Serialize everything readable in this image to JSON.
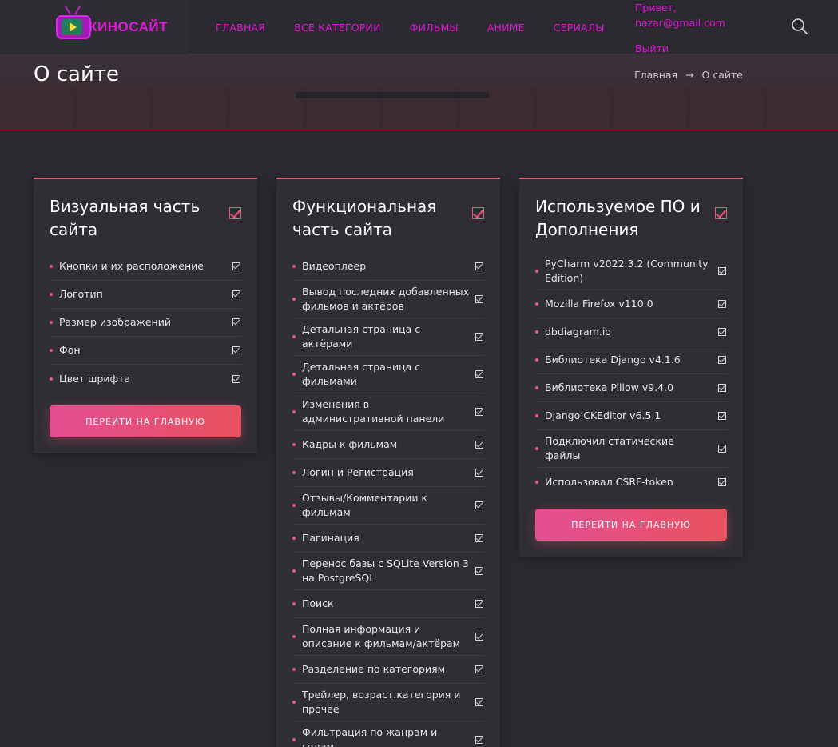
{
  "header": {
    "logo_text": "КИНОСАЙТ",
    "nav": [
      "ГЛАВНАЯ",
      "ВСЕ КАТЕГОРИИ",
      "ФИЛЬМЫ",
      "АНИМЕ",
      "СЕРИАЛЫ"
    ],
    "greeting": "Привет,",
    "email": "nazar@gmail.com",
    "logout": "Выйти",
    "search_icon": "search-icon"
  },
  "hero": {
    "title": "О сайте",
    "breadcrumb_home": "Главная",
    "breadcrumb_sep": "→",
    "breadcrumb_current": "О сайте"
  },
  "cards": [
    {
      "title": "Визуальная часть сайта",
      "items": [
        "Кнопки и их расположение",
        "Логотип",
        "Размер изображений",
        "Фон",
        "Цвет шрифта"
      ],
      "button": "ПЕРЕЙТИ НА ГЛАВНУЮ"
    },
    {
      "title": "Функциональная часть сайта",
      "items": [
        "Видеоплеер",
        "Вывод последних добавленных фильмов и актёров",
        "Детальная страница с актёрами",
        "Детальная страница с фильмами",
        "Изменения в административной панели",
        "Кадры к фильмам",
        "Логин и Регистрация",
        "Отзывы/Комментарии к фильмам",
        "Пагинация",
        "Перенос базы с SQLite Version 3 на PostgreSQL",
        "Поиск",
        "Полная информация и описание к фильмам/актёрам",
        "Разделение по категориям",
        "Трейлер, возраст.категория и прочее",
        "Фильтрация по жанрам и годам"
      ]
    },
    {
      "title": "Используемое ПО и Дополнения",
      "items": [
        "PyCharm v2022.3.2 (Community Edition)",
        "Mozilla Firefox v110.0",
        "dbdiagram.io",
        "Библиотека Django v4.1.6",
        "Библиотека Pillow v9.4.0",
        "Django CKEditor v6.5.1",
        "Подключил статические файлы",
        "Использовал CSRF-token"
      ],
      "button": "ПЕРЕЙТИ НА ГЛАВНУЮ"
    }
  ],
  "colors": {
    "accent": "#eb5874",
    "nav": "#e312d9",
    "background": "#2b2a30",
    "card": "#2f2e35"
  }
}
